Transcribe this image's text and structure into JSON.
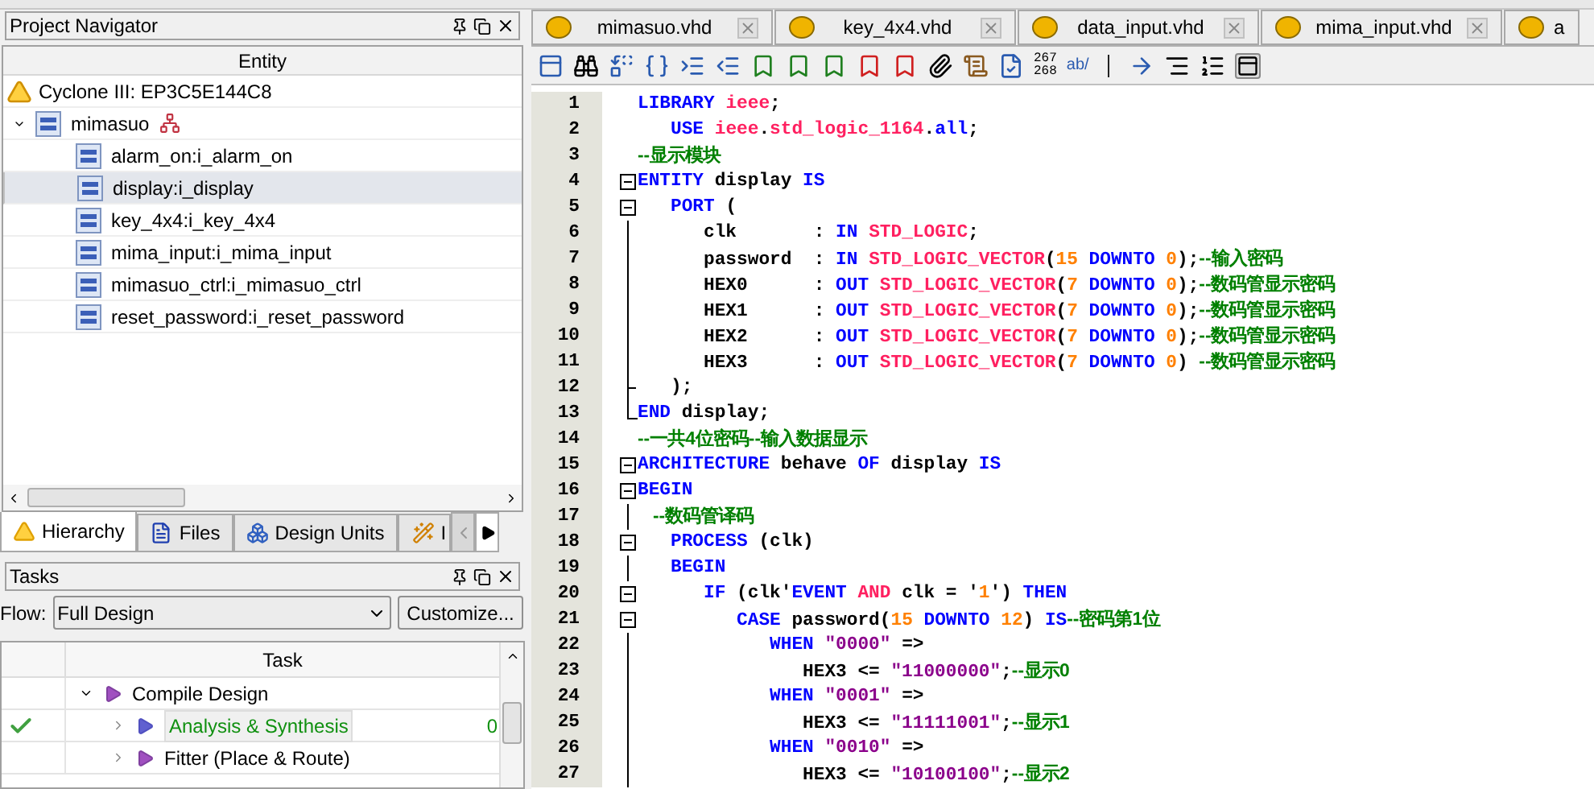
{
  "navigator": {
    "title": "Project Navigator",
    "column": "Entity",
    "device": "Cyclone III: EP3C5E144C8",
    "tree": [
      {
        "label": "mimasuo",
        "expanded": true,
        "selected": false,
        "children": [
          {
            "label": "alarm_on:i_alarm_on",
            "selected": false
          },
          {
            "label": "display:i_display",
            "selected": true
          },
          {
            "label": "key_4x4:i_key_4x4",
            "selected": false
          },
          {
            "label": "mima_input:i_mima_input",
            "selected": false
          },
          {
            "label": "mimasuo_ctrl:i_mimasuo_ctrl",
            "selected": false
          },
          {
            "label": "reset_password:i_reset_password",
            "selected": false
          }
        ]
      }
    ],
    "tabs": [
      {
        "label": "Hierarchy",
        "kind": "hierarchy",
        "selected": true
      },
      {
        "label": "Files",
        "kind": "files",
        "selected": false
      },
      {
        "label": "Design Units",
        "kind": "units",
        "selected": false
      },
      {
        "label": "I",
        "kind": "wand",
        "selected": false
      }
    ]
  },
  "tasks": {
    "title": "Tasks",
    "flow_label": "Flow:",
    "flow_value": "Full Design",
    "customize": "Customize...",
    "column": "Task",
    "rows": [
      {
        "label": "Compile Design",
        "expanded": true,
        "done": false,
        "kind": "group"
      },
      {
        "label": "Analysis & Synthesis",
        "expanded": false,
        "done": true,
        "kind": "step",
        "status": "0"
      },
      {
        "label": "Fitter (Place & Route)",
        "expanded": false,
        "done": false,
        "kind": "step"
      }
    ]
  },
  "editor": {
    "tabs": [
      {
        "label": "mimasuo.vhd",
        "selected": false
      },
      {
        "label": "key_4x4.vhd",
        "selected": false
      },
      {
        "label": "data_input.vhd",
        "selected": false
      },
      {
        "label": "mima_input.vhd",
        "selected": false
      },
      {
        "label": "a",
        "selected": false
      }
    ],
    "line_numbers_label": "267\n268",
    "ab_label": "ab/",
    "lines": [
      {
        "n": "1",
        "kind": "plain",
        "tokens": [
          {
            "kind": "kw",
            "t": "LIBRARY "
          },
          {
            "kind": "ty",
            "t": "ieee"
          },
          {
            "kind": "p",
            "t": ";"
          }
        ]
      },
      {
        "n": "2",
        "kind": "plain",
        "tokens": [
          {
            "kind": "kw",
            "t": "   USE "
          },
          {
            "kind": "ty",
            "t": "ieee"
          },
          {
            "kind": "p",
            "t": "."
          },
          {
            "kind": "ty",
            "t": "std_logic_1164"
          },
          {
            "kind": "p",
            "t": "."
          },
          {
            "kind": "kw",
            "t": "all"
          },
          {
            "kind": "p",
            "t": ";"
          }
        ]
      },
      {
        "n": "3",
        "kind": "plain",
        "tokens": [
          {
            "kind": "c",
            "t": "--显示模块"
          }
        ]
      },
      {
        "n": "4",
        "kind": "fold",
        "tokens": [
          {
            "kind": "kw",
            "t": "ENTITY"
          },
          {
            "kind": "p",
            "t": " display "
          },
          {
            "kind": "kw",
            "t": "IS"
          }
        ]
      },
      {
        "n": "5",
        "kind": "fold",
        "tokens": [
          {
            "kind": "kw",
            "t": "   PORT"
          },
          {
            "kind": "p",
            "t": " ("
          }
        ]
      },
      {
        "n": "6",
        "kind": "line",
        "tokens": [
          {
            "kind": "p",
            "t": "      clk       : "
          },
          {
            "kind": "kw",
            "t": "IN "
          },
          {
            "kind": "ty",
            "t": "STD_LOGIC"
          },
          {
            "kind": "p",
            "t": ";"
          }
        ]
      },
      {
        "n": "7",
        "kind": "line",
        "tokens": [
          {
            "kind": "p",
            "t": "      password  : "
          },
          {
            "kind": "kw",
            "t": "IN "
          },
          {
            "kind": "ty",
            "t": "STD_LOGIC_VECTOR"
          },
          {
            "kind": "p",
            "t": "("
          },
          {
            "kind": "n",
            "t": "15 "
          },
          {
            "kind": "kw",
            "t": "DOWNTO "
          },
          {
            "kind": "n",
            "t": "0"
          },
          {
            "kind": "p",
            "t": ");"
          },
          {
            "kind": "c",
            "t": "--输入密码"
          }
        ]
      },
      {
        "n": "8",
        "kind": "line",
        "tokens": [
          {
            "kind": "p",
            "t": "      HEX0      : "
          },
          {
            "kind": "kw",
            "t": "OUT "
          },
          {
            "kind": "ty",
            "t": "STD_LOGIC_VECTOR"
          },
          {
            "kind": "p",
            "t": "("
          },
          {
            "kind": "n",
            "t": "7 "
          },
          {
            "kind": "kw",
            "t": "DOWNTO "
          },
          {
            "kind": "n",
            "t": "0"
          },
          {
            "kind": "p",
            "t": ");"
          },
          {
            "kind": "c",
            "t": "--数码管显示密码"
          }
        ]
      },
      {
        "n": "9",
        "kind": "line",
        "tokens": [
          {
            "kind": "p",
            "t": "      HEX1      : "
          },
          {
            "kind": "kw",
            "t": "OUT "
          },
          {
            "kind": "ty",
            "t": "STD_LOGIC_VECTOR"
          },
          {
            "kind": "p",
            "t": "("
          },
          {
            "kind": "n",
            "t": "7 "
          },
          {
            "kind": "kw",
            "t": "DOWNTO "
          },
          {
            "kind": "n",
            "t": "0"
          },
          {
            "kind": "p",
            "t": ");"
          },
          {
            "kind": "c",
            "t": "--数码管显示密码"
          }
        ]
      },
      {
        "n": "10",
        "kind": "line",
        "tokens": [
          {
            "kind": "p",
            "t": "      HEX2      : "
          },
          {
            "kind": "kw",
            "t": "OUT "
          },
          {
            "kind": "ty",
            "t": "STD_LOGIC_VECTOR"
          },
          {
            "kind": "p",
            "t": "("
          },
          {
            "kind": "n",
            "t": "7 "
          },
          {
            "kind": "kw",
            "t": "DOWNTO "
          },
          {
            "kind": "n",
            "t": "0"
          },
          {
            "kind": "p",
            "t": ");"
          },
          {
            "kind": "c",
            "t": "--数码管显示密码"
          }
        ]
      },
      {
        "n": "11",
        "kind": "line",
        "tokens": [
          {
            "kind": "p",
            "t": "      HEX3      : "
          },
          {
            "kind": "kw",
            "t": "OUT "
          },
          {
            "kind": "ty",
            "t": "STD_LOGIC_VECTOR"
          },
          {
            "kind": "p",
            "t": "("
          },
          {
            "kind": "n",
            "t": "7 "
          },
          {
            "kind": "kw",
            "t": "DOWNTO "
          },
          {
            "kind": "n",
            "t": "0"
          },
          {
            "kind": "p",
            "t": ") "
          },
          {
            "kind": "c",
            "t": "--数码管显示密码"
          }
        ]
      },
      {
        "n": "12",
        "kind": "tee",
        "tokens": [
          {
            "kind": "p",
            "t": "   );"
          }
        ]
      },
      {
        "n": "13",
        "kind": "end",
        "tokens": [
          {
            "kind": "kw",
            "t": "END"
          },
          {
            "kind": "p",
            "t": " display;"
          }
        ]
      },
      {
        "n": "14",
        "kind": "plain",
        "tokens": [
          {
            "kind": "c",
            "t": "--一共4位密码--输入数据显示"
          }
        ]
      },
      {
        "n": "15",
        "kind": "fold",
        "tokens": [
          {
            "kind": "kw",
            "t": "ARCHITECTURE"
          },
          {
            "kind": "p",
            "t": " behave "
          },
          {
            "kind": "kw",
            "t": "OF"
          },
          {
            "kind": "p",
            "t": " display "
          },
          {
            "kind": "kw",
            "t": "IS"
          }
        ]
      },
      {
        "n": "16",
        "kind": "fold",
        "tokens": [
          {
            "kind": "kw",
            "t": "BEGIN"
          }
        ]
      },
      {
        "n": "17",
        "kind": "line",
        "tokens": [
          {
            "kind": "c",
            "t": "   --数码管译码"
          }
        ]
      },
      {
        "n": "18",
        "kind": "fold",
        "tokens": [
          {
            "kind": "kw",
            "t": "   PROCESS"
          },
          {
            "kind": "p",
            "t": " (clk)"
          }
        ]
      },
      {
        "n": "19",
        "kind": "line",
        "tokens": [
          {
            "kind": "kw",
            "t": "   BEGIN"
          }
        ]
      },
      {
        "n": "20",
        "kind": "fold",
        "tokens": [
          {
            "kind": "kw",
            "t": "      IF"
          },
          {
            "kind": "p",
            "t": " (clk'"
          },
          {
            "kind": "kw",
            "t": "EVENT "
          },
          {
            "kind": "ty",
            "t": "AND"
          },
          {
            "kind": "p",
            "t": " clk = '"
          },
          {
            "kind": "n",
            "t": "1"
          },
          {
            "kind": "p",
            "t": "') "
          },
          {
            "kind": "kw",
            "t": "THEN"
          }
        ]
      },
      {
        "n": "21",
        "kind": "fold",
        "tokens": [
          {
            "kind": "kw",
            "t": "         CASE"
          },
          {
            "kind": "p",
            "t": " password("
          },
          {
            "kind": "n",
            "t": "15 "
          },
          {
            "kind": "kw",
            "t": "DOWNTO "
          },
          {
            "kind": "n",
            "t": "12"
          },
          {
            "kind": "p",
            "t": ") "
          },
          {
            "kind": "kw",
            "t": "IS"
          },
          {
            "kind": "c",
            "t": "--密码第1位"
          }
        ]
      },
      {
        "n": "22",
        "kind": "line",
        "tokens": [
          {
            "kind": "kw",
            "t": "            WHEN "
          },
          {
            "kind": "s",
            "t": "\"0000\""
          },
          {
            "kind": "p",
            "t": " =>"
          }
        ]
      },
      {
        "n": "23",
        "kind": "line",
        "tokens": [
          {
            "kind": "p",
            "t": "               HEX3 <= "
          },
          {
            "kind": "s",
            "t": "\"11000000\""
          },
          {
            "kind": "p",
            "t": ";"
          },
          {
            "kind": "c",
            "t": "--显示0"
          }
        ]
      },
      {
        "n": "24",
        "kind": "line",
        "tokens": [
          {
            "kind": "kw",
            "t": "            WHEN "
          },
          {
            "kind": "s",
            "t": "\"0001\""
          },
          {
            "kind": "p",
            "t": " =>"
          }
        ]
      },
      {
        "n": "25",
        "kind": "line",
        "tokens": [
          {
            "kind": "p",
            "t": "               HEX3 <= "
          },
          {
            "kind": "s",
            "t": "\"11111001\""
          },
          {
            "kind": "p",
            "t": ";"
          },
          {
            "kind": "c",
            "t": "--显示1"
          }
        ]
      },
      {
        "n": "26",
        "kind": "line",
        "tokens": [
          {
            "kind": "kw",
            "t": "            WHEN "
          },
          {
            "kind": "s",
            "t": "\"0010\""
          },
          {
            "kind": "p",
            "t": " =>"
          }
        ]
      },
      {
        "n": "27",
        "kind": "line",
        "tokens": [
          {
            "kind": "p",
            "t": "               HEX3 <= "
          },
          {
            "kind": "s",
            "t": "\"10100100\""
          },
          {
            "kind": "p",
            "t": ";"
          },
          {
            "kind": "c",
            "t": "--显示2"
          }
        ]
      }
    ]
  }
}
